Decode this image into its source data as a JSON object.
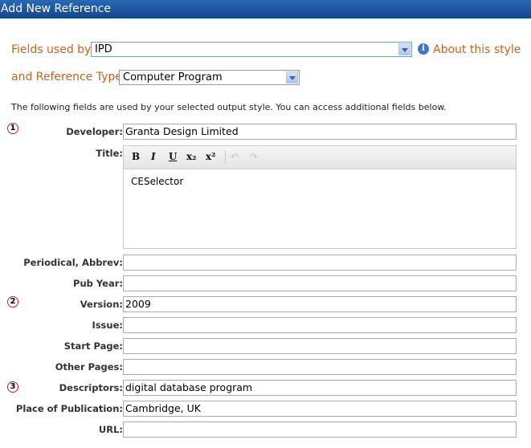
{
  "window": {
    "title": "Add New Reference"
  },
  "style_row": {
    "label": "Fields used by",
    "value": "IPD",
    "about_link": "About this style",
    "info_icon": "info-icon"
  },
  "reftype_row": {
    "label": "and Reference Type",
    "value": "Computer Program"
  },
  "note": "The following fields are used by your selected output style. You can access additional fields below.",
  "fields": {
    "developer": {
      "label": "Developer:",
      "value": "Granta Design Limited"
    },
    "title": {
      "label": "Title:",
      "value": "CESelector"
    },
    "periodical": {
      "label": "Periodical, Abbrev:",
      "value": ""
    },
    "pub_year": {
      "label": "Pub Year:",
      "value": ""
    },
    "version": {
      "label": "Version:",
      "value": "2009"
    },
    "issue": {
      "label": "Issue:",
      "value": ""
    },
    "start_page": {
      "label": "Start Page:",
      "value": ""
    },
    "other_pages": {
      "label": "Other Pages:",
      "value": ""
    },
    "descriptors": {
      "label": "Descriptors:",
      "value": "digital database program"
    },
    "place": {
      "label": "Place of Publication:",
      "value": "Cambridge, UK"
    },
    "url": {
      "label": "URL:",
      "value": ""
    }
  },
  "markers": [
    "1",
    "2",
    "3"
  ],
  "toolbar": {
    "bold": "B",
    "italic": "I",
    "underline": "U",
    "subscript": "x₂",
    "superscript": "x²",
    "undo": "↶",
    "redo": "↷"
  }
}
